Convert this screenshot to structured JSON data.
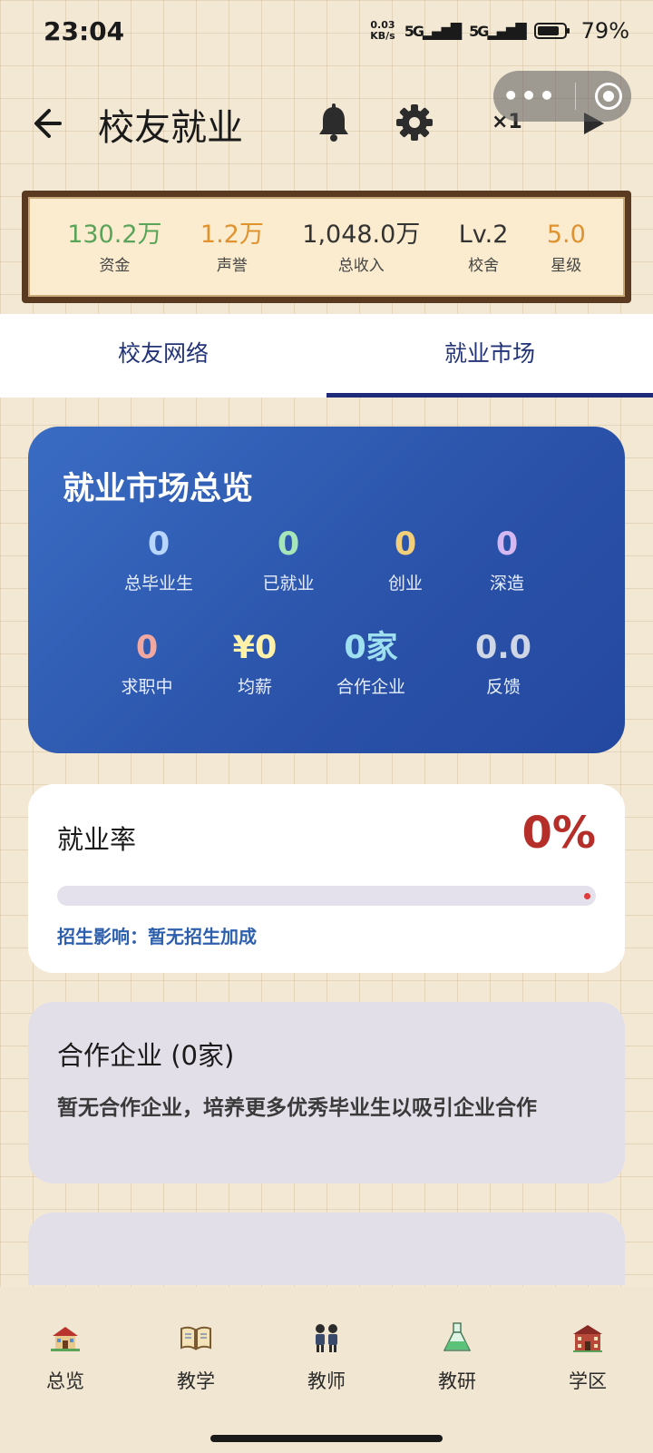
{
  "status": {
    "time": "23:04",
    "net_speed_top": "0.03",
    "net_speed_bottom": "KB/s",
    "signal1": "5G",
    "signal2": "5G",
    "battery": "79%"
  },
  "header": {
    "title": "校友就业",
    "speed": "×1"
  },
  "resources": [
    {
      "value": "130.2万",
      "label": "资金",
      "color": "#5aa45a"
    },
    {
      "value": "1.2万",
      "label": "声誉",
      "color": "#e0922e"
    },
    {
      "value": "1,048.0万",
      "label": "总收入",
      "color": "#333333"
    },
    {
      "value": "Lv.2",
      "label": "校舍",
      "color": "#333333"
    },
    {
      "value": "5.0",
      "label": "星级",
      "color": "#e0922e"
    }
  ],
  "tabs": [
    {
      "label": "校友网络"
    },
    {
      "label": "就业市场"
    }
  ],
  "overview": {
    "title": "就业市场总览",
    "row1": [
      {
        "value": "0",
        "label": "总毕业生",
        "color": "#b9d6ff"
      },
      {
        "value": "0",
        "label": "已就业",
        "color": "#a6e6b8"
      },
      {
        "value": "0",
        "label": "创业",
        "color": "#f3cf7a"
      },
      {
        "value": "0",
        "label": "深造",
        "color": "#d5b8f2"
      }
    ],
    "row2": [
      {
        "value": "0",
        "label": "求职中",
        "color": "#f0a8a0"
      },
      {
        "value": "¥0",
        "label": "均薪",
        "color": "#fff2a8"
      },
      {
        "value": "0家",
        "label": "合作企业",
        "color": "#9fe0f0"
      },
      {
        "value": "0.0",
        "label": "反馈",
        "color": "#cfd6e6"
      }
    ]
  },
  "employment_rate": {
    "label": "就业率",
    "value": "0%",
    "progress": 0,
    "note": "招生影响：暂无招生加成"
  },
  "partners": {
    "title": "合作企业 (0家)",
    "text": "暂无合作企业，培养更多优秀毕业生以吸引企业合作"
  },
  "bottom_nav": [
    {
      "label": "总览",
      "icon": "school-house-icon"
    },
    {
      "label": "教学",
      "icon": "open-book-icon"
    },
    {
      "label": "教师",
      "icon": "teachers-icon"
    },
    {
      "label": "教研",
      "icon": "flask-icon"
    },
    {
      "label": "学区",
      "icon": "campus-building-icon"
    }
  ]
}
